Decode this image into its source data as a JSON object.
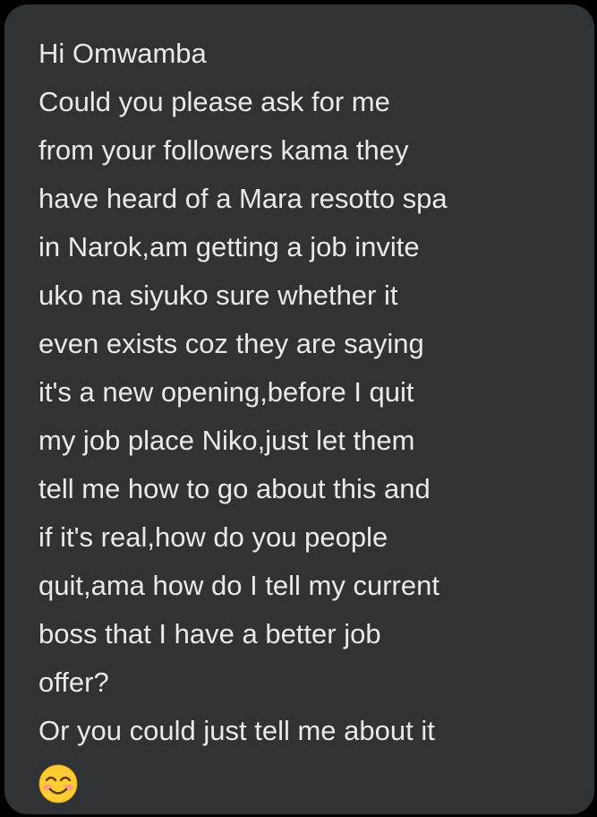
{
  "message": {
    "lines": [
      "Hi Omwamba",
      "Could you please ask for me",
      "from your followers kama they",
      "have heard of a Mara resotto spa",
      "in Narok,am getting a job invite",
      "uko na siyuko sure whether it",
      "even exists coz they are saying",
      "it's a new opening,before I quit",
      "my job place Niko,just let them",
      "tell me how to go about this and",
      "if it's real,how do you people",
      "quit,ama how do I tell my current",
      "boss that I have a better job",
      "offer?",
      "Or you could just tell me about it"
    ],
    "emoji_icon": "smiling-face-with-smiling-eyes-emoji"
  },
  "colors": {
    "background": "#000000",
    "bubble": "#2f3336",
    "text": "#e7e9ea"
  }
}
